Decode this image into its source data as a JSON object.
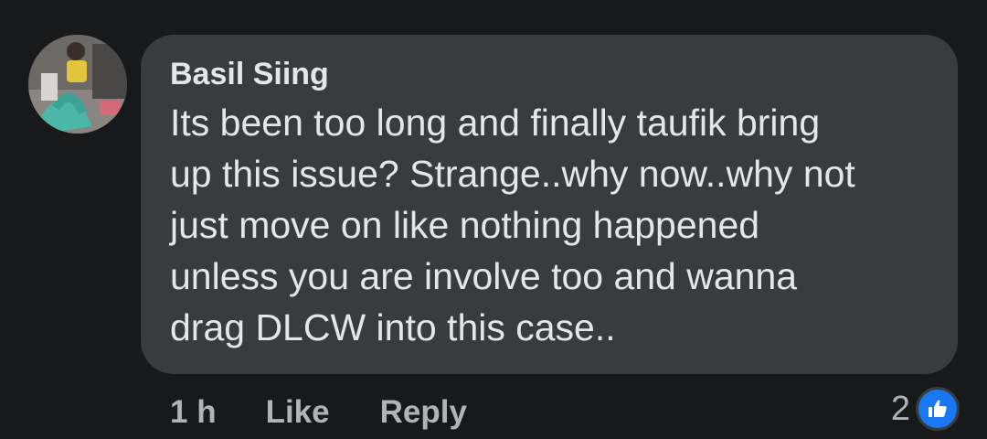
{
  "comment": {
    "author": "Basil Siing",
    "text_lines": [
      "Its been too long and finally taufik bring",
      "up this issue? Strange..why now..why not",
      "just move on like nothing happened",
      "unless you are involve too and wanna",
      "drag DLCW into this case.."
    ],
    "timestamp": "1 h",
    "like_label": "Like",
    "reply_label": "Reply",
    "reaction_count": "2",
    "reaction_icon": "like-thumb-icon"
  },
  "colors": {
    "background": "#18191a",
    "bubble": "#3a3b3c",
    "primary_text": "#e4e6eb",
    "secondary_text": "#b0b3b8",
    "like_blue": "#1877f2"
  }
}
